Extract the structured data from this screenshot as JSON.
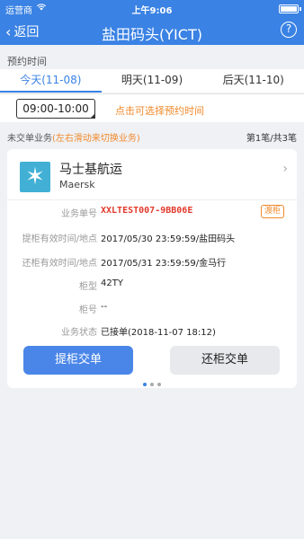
{
  "status_bar": {
    "carrier": "运营商",
    "time": "上午9:06"
  },
  "nav": {
    "back_label": "返回",
    "title": "盐田码头(YICT)",
    "help_label": "?"
  },
  "appointment": {
    "section_label": "预约时间",
    "tabs": [
      {
        "label": "今天(11-08)",
        "active": true
      },
      {
        "label": "明天(11-09)",
        "active": false
      },
      {
        "label": "后天(11-10)",
        "active": false
      }
    ],
    "time_slot": "09:00-10:00",
    "time_hint": "点击可选择预约时间"
  },
  "pending": {
    "label": "未交单业务",
    "hint": "(左右滑动来切换业务)",
    "pagination": "第1笔/共3笔"
  },
  "card": {
    "company_name": "马士基航运",
    "company_en": "Maersk",
    "fields": {
      "biz_no_label": "业务单号",
      "biz_no_value": "XXLTEST007-9BB06E",
      "biz_tag": "渡柜",
      "pickup_label": "提柜有效时间/地点",
      "pickup_value": "2017/05/30 23:59:59/盐田码头",
      "return_label": "还柜有效时间/地点",
      "return_value": "2017/05/31 23:59:59/金马行",
      "type_label": "柜型",
      "type_value": "42TY",
      "container_label": "柜号",
      "container_value": "--",
      "status_label": "业务状态",
      "status_value": "已接单(2018-11-07 18:12)"
    },
    "primary_button": "提柜交单",
    "secondary_button": "还柜交单"
  },
  "colors": {
    "accent": "#3a82e4",
    "warning": "#f08a2c",
    "danger": "#e23a2c",
    "logo": "#42b0d5"
  },
  "icons": {
    "logo": "maersk-star-icon",
    "back": "chevron-left-icon",
    "help": "question-circle-icon",
    "card": "chevron-right-icon"
  }
}
